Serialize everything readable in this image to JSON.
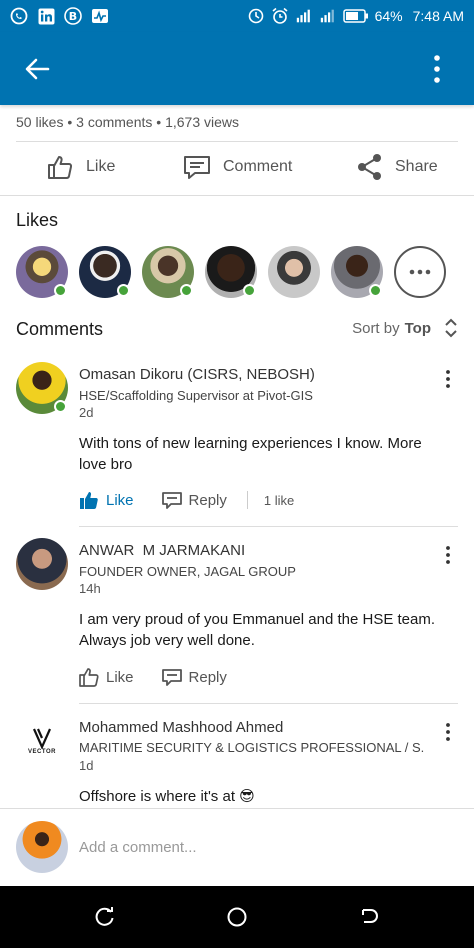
{
  "status_bar": {
    "battery": "64%",
    "time": "7:48 AM",
    "icons": [
      "whatsapp-icon",
      "linkedin-icon",
      "bitcoin-icon",
      "activity-icon",
      "sync-icon",
      "alarm-icon",
      "signal-icon",
      "signal-icon",
      "battery-icon"
    ]
  },
  "post_stats": {
    "summary": "50 likes • 3 comments • 1,673 views"
  },
  "actions": {
    "like": "Like",
    "comment": "Comment",
    "share": "Share"
  },
  "likes_section": {
    "title": "Likes"
  },
  "comments_section": {
    "title": "Comments",
    "sort_prefix": "Sort by",
    "sort_value": "Top"
  },
  "comments": [
    {
      "name": "Omasan Dikoru (CISRS, NEBOSH)",
      "headline": "HSE/Scaffolding Supervisor at Pivot-GIS",
      "time": "2d",
      "body": "With tons of new learning experiences I know. More love bro",
      "like_label": "Like",
      "reply_label": "Reply",
      "like_count": "1 like"
    },
    {
      "name": "ANWAR  M JARMAKANI",
      "headline": "FOUNDER OWNER, JAGAL GROUP",
      "time": "14h",
      "body": "I am very proud of you Emmanuel and the HSE team. Always job very well done.",
      "like_label": "Like",
      "reply_label": "Reply"
    },
    {
      "name": "Mohammed Mashhood Ahmed",
      "headline": "MARITIME SECURITY & LOGISTICS PROFESSIONAL / S...",
      "time": "1d",
      "body": "Offshore is where it's at 😎",
      "avatar_text": "VECTOR"
    }
  ],
  "composer": {
    "placeholder": "Add a comment..."
  },
  "colors": {
    "brand": "#0073b1",
    "online": "#46a33a"
  }
}
